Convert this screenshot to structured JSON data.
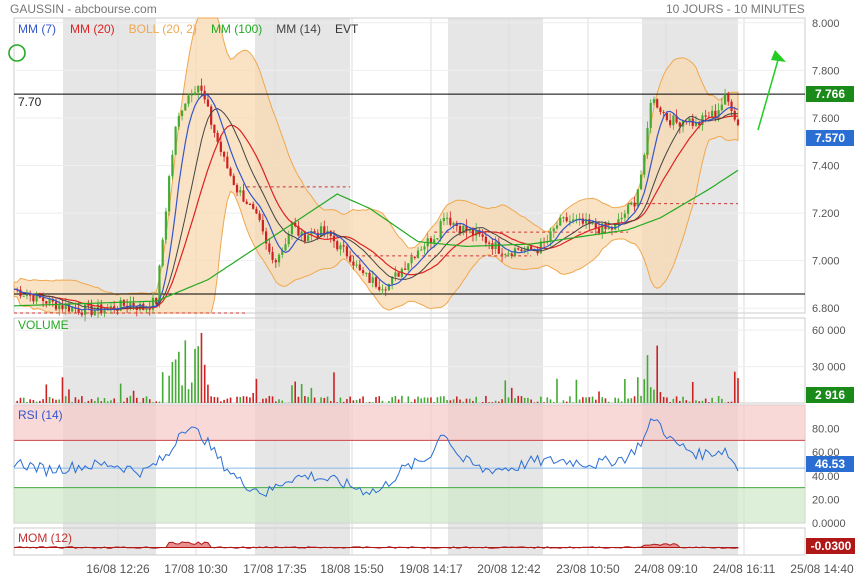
{
  "header": {
    "left": "GAUSSIN - abcbourse.com",
    "right": "10 JOURS - 10 MINUTES"
  },
  "legend": [
    {
      "label": "MM (7)",
      "color": "#3355cc"
    },
    {
      "label": "MM (20)",
      "color": "#dd2222"
    },
    {
      "label": "BOLL (20, 2)",
      "color": "#f0a850"
    },
    {
      "label": "MM (100)",
      "color": "#22aa22"
    },
    {
      "label": "MM (14)",
      "color": "#444444"
    },
    {
      "label": "EVT",
      "color": "#333333"
    }
  ],
  "panels": {
    "volume": "VOLUME",
    "rsi": "RSI (14)",
    "mom": "MOM (12)"
  },
  "tags": {
    "high_price": "7.766",
    "last_price": "7.570",
    "volume": "2 916",
    "rsi": "46.53",
    "mom": "-0.0300"
  },
  "level_label": "7.70",
  "chart_data": [
    {
      "type": "line",
      "panel": "price",
      "x_ticks": [
        "16/08 12:26",
        "17/08 10:30",
        "17/08 17:35",
        "18/08 15:50",
        "19/08 14:17",
        "20/08 12:42",
        "23/08 10:50",
        "24/08 09:10",
        "24/08 16:11",
        "25/08 14:40"
      ],
      "y_ticks": [
        "8.000",
        "7.800",
        "7.600",
        "7.400",
        "7.200",
        "7.000",
        "6.800"
      ],
      "ylim": [
        6.78,
        8.02
      ],
      "hlines": [
        7.7,
        6.86
      ],
      "last": 7.57,
      "high": 7.766,
      "close_path": [
        [
          0,
          6.88
        ],
        [
          6,
          6.85
        ],
        [
          12,
          6.82
        ],
        [
          18,
          6.8
        ],
        [
          24,
          6.79
        ],
        [
          30,
          6.8
        ],
        [
          36,
          6.82
        ],
        [
          40,
          6.8
        ],
        [
          44,
          6.83
        ],
        [
          48,
          7.35
        ],
        [
          50,
          7.55
        ],
        [
          52,
          7.65
        ],
        [
          55,
          7.72
        ],
        [
          57,
          7.74
        ],
        [
          59,
          7.67
        ],
        [
          61,
          7.58
        ],
        [
          63,
          7.5
        ],
        [
          65,
          7.42
        ],
        [
          67,
          7.36
        ],
        [
          69,
          7.3
        ],
        [
          72,
          7.25
        ],
        [
          74,
          7.2
        ],
        [
          76,
          7.15
        ],
        [
          78,
          7.06
        ],
        [
          80,
          7.0
        ],
        [
          83,
          7.05
        ],
        [
          86,
          7.15
        ],
        [
          89,
          7.1
        ],
        [
          92,
          7.12
        ],
        [
          95,
          7.12
        ],
        [
          98,
          7.1
        ],
        [
          101,
          7.05
        ],
        [
          104,
          7.02
        ],
        [
          107,
          6.95
        ],
        [
          110,
          6.92
        ],
        [
          113,
          6.9
        ],
        [
          116,
          6.9
        ],
        [
          119,
          6.95
        ],
        [
          122,
          7.0
        ],
        [
          125,
          7.05
        ],
        [
          128,
          7.08
        ],
        [
          131,
          7.12
        ],
        [
          133,
          7.2
        ],
        [
          135,
          7.17
        ],
        [
          138,
          7.14
        ],
        [
          141,
          7.12
        ],
        [
          144,
          7.1
        ],
        [
          147,
          7.08
        ],
        [
          150,
          7.05
        ],
        [
          153,
          7.04
        ],
        [
          156,
          7.05
        ],
        [
          159,
          7.04
        ],
        [
          162,
          7.05
        ],
        [
          165,
          7.08
        ],
        [
          168,
          7.15
        ],
        [
          171,
          7.17
        ],
        [
          174,
          7.16
        ],
        [
          177,
          7.15
        ],
        [
          180,
          7.14
        ],
        [
          183,
          7.13
        ],
        [
          186,
          7.14
        ],
        [
          189,
          7.2
        ],
        [
          192,
          7.25
        ],
        [
          195,
          7.42
        ],
        [
          197,
          7.68
        ],
        [
          199,
          7.66
        ],
        [
          202,
          7.6
        ],
        [
          205,
          7.58
        ],
        [
          208,
          7.6
        ],
        [
          211,
          7.57
        ],
        [
          214,
          7.6
        ],
        [
          217,
          7.62
        ],
        [
          220,
          7.68
        ],
        [
          222,
          7.65
        ],
        [
          224,
          7.57
        ]
      ],
      "ma100_path": [
        [
          0,
          6.81
        ],
        [
          44,
          6.83
        ],
        [
          60,
          6.92
        ],
        [
          80,
          7.1
        ],
        [
          100,
          7.28
        ],
        [
          110,
          7.22
        ],
        [
          125,
          7.08
        ],
        [
          140,
          7.06
        ],
        [
          160,
          7.07
        ],
        [
          190,
          7.13
        ],
        [
          200,
          7.18
        ],
        [
          215,
          7.3
        ],
        [
          224,
          7.38
        ]
      ],
      "dashed_levels": [
        {
          "from": 72,
          "to": 104,
          "y": 7.31
        },
        {
          "from": 0,
          "to": 72,
          "y": 6.78
        },
        {
          "from": 104,
          "to": 160,
          "y": 7.02
        },
        {
          "from": 130,
          "to": 190,
          "y": 7.12
        },
        {
          "from": 190,
          "to": 224,
          "y": 7.24
        }
      ]
    },
    {
      "type": "bar",
      "panel": "volume",
      "y_ticks": [
        "60 000",
        "30 000"
      ],
      "ylim": [
        0,
        70000
      ],
      "last": 2916
    },
    {
      "type": "line",
      "panel": "rsi",
      "y_ticks": [
        "80.00",
        "60.00",
        "40.00",
        "20.00",
        "0.0000"
      ],
      "ylim": [
        0,
        100
      ],
      "bands": [
        70,
        30
      ],
      "last": 46.53,
      "rsi_path": [
        [
          0,
          52
        ],
        [
          10,
          45
        ],
        [
          20,
          48
        ],
        [
          30,
          50
        ],
        [
          40,
          43
        ],
        [
          48,
          58
        ],
        [
          52,
          82
        ],
        [
          58,
          75
        ],
        [
          64,
          52
        ],
        [
          70,
          35
        ],
        [
          78,
          25
        ],
        [
          85,
          38
        ],
        [
          92,
          40
        ],
        [
          100,
          35
        ],
        [
          108,
          28
        ],
        [
          113,
          27
        ],
        [
          120,
          45
        ],
        [
          128,
          55
        ],
        [
          133,
          78
        ],
        [
          138,
          55
        ],
        [
          145,
          45
        ],
        [
          155,
          47
        ],
        [
          160,
          52
        ],
        [
          170,
          53
        ],
        [
          180,
          50
        ],
        [
          190,
          56
        ],
        [
          195,
          72
        ],
        [
          198,
          90
        ],
        [
          204,
          68
        ],
        [
          212,
          58
        ],
        [
          220,
          62
        ],
        [
          224,
          46
        ]
      ]
    },
    {
      "type": "area",
      "panel": "mom",
      "last": -0.03
    }
  ]
}
